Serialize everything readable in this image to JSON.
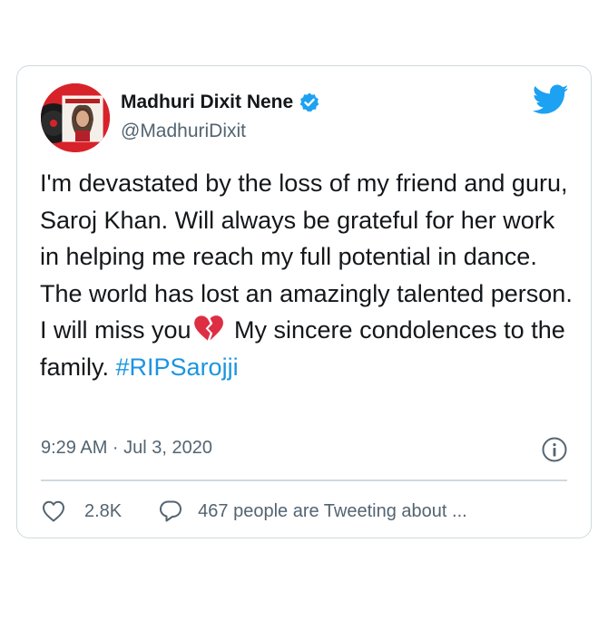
{
  "tweet": {
    "author": {
      "display_name": "Madhuri Dixit Nene",
      "handle": "@MadhuriDixit",
      "verified": true,
      "avatar_icon": "profile-photo-icon"
    },
    "text": "I'm devastated by the loss of my friend and guru, Saroj Khan. Will always be grateful for her work in helping me reach my full potential in dance. The world has lost an amazingly talented person. I will miss you",
    "emoji": "broken-heart",
    "text_after_emoji": " My sincere condolences to the family. ",
    "hashtag": "#RIPSarojji",
    "timestamp": "9:29 AM · Jul 3, 2020",
    "likes": "2.8K",
    "conversation": "467 people are Tweeting about ..."
  },
  "icons": {
    "brand": "twitter-bird-icon",
    "verified": "verified-badge-icon",
    "info": "info-icon",
    "like": "heart-outline-icon",
    "reply": "speech-bubble-icon"
  },
  "colors": {
    "twitter_blue": "#1da1f2",
    "link_blue": "#1b95e0",
    "text_primary": "#14171a",
    "text_secondary": "#536471",
    "border": "#cfd9de",
    "broken_heart": "#dd2e44"
  }
}
